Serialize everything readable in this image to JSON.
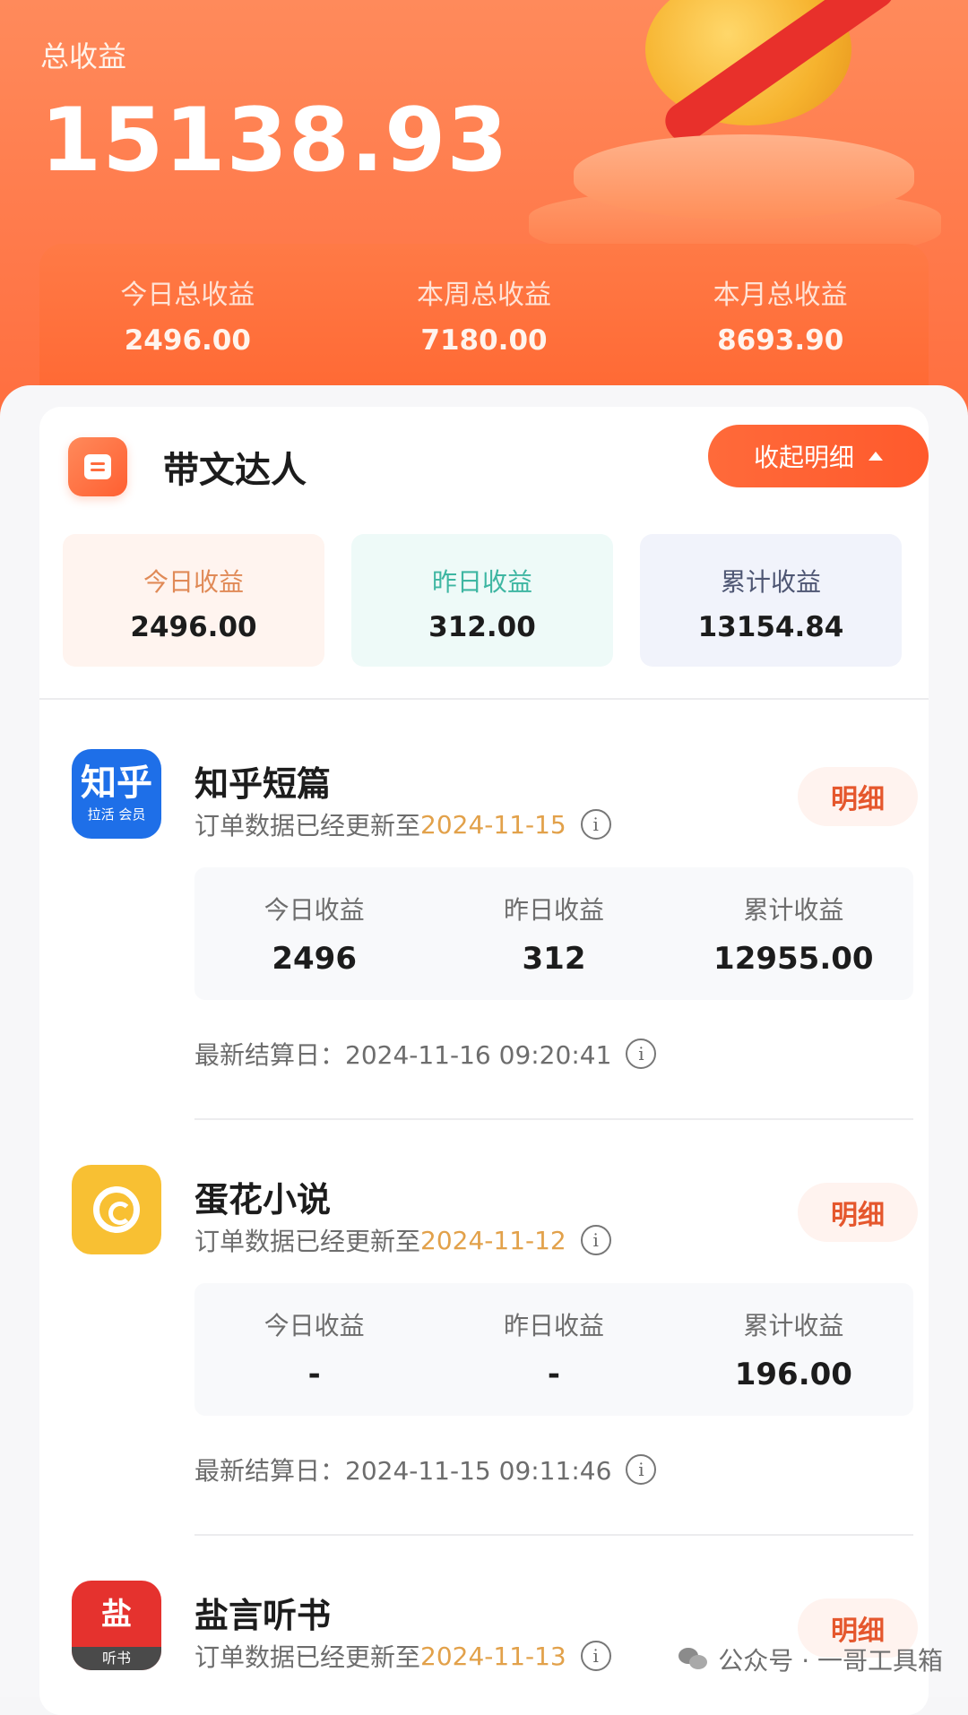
{
  "header": {
    "total_label": "总收益",
    "total_value": "15138.93",
    "summary": [
      {
        "label": "今日总收益",
        "value": "2496.00"
      },
      {
        "label": "本周总收益",
        "value": "7180.00"
      },
      {
        "label": "本月总收益",
        "value": "8693.90"
      }
    ]
  },
  "section": {
    "title": "带文达人",
    "collapse_label": "收起明细",
    "stats": [
      {
        "label": "今日收益",
        "value": "2496.00"
      },
      {
        "label": "昨日收益",
        "value": "312.00"
      },
      {
        "label": "累计收益",
        "value": "13154.84"
      }
    ]
  },
  "platforms": [
    {
      "name": "知乎短篇",
      "logo_text": "知乎",
      "logo_sub": "拉活 会员",
      "update_prefix": "订单数据已经更新至",
      "update_date": "2024-11-15",
      "detail_label": "明细",
      "stats": [
        {
          "label": "今日收益",
          "value": "2496"
        },
        {
          "label": "昨日收益",
          "value": "312"
        },
        {
          "label": "累计收益",
          "value": "12955.00"
        }
      ],
      "settle_label": "最新结算日：2024-11-16 09:20:41"
    },
    {
      "name": "蛋花小说",
      "update_prefix": "订单数据已经更新至",
      "update_date": "2024-11-12",
      "detail_label": "明细",
      "stats": [
        {
          "label": "今日收益",
          "value": "-"
        },
        {
          "label": "昨日收益",
          "value": "-"
        },
        {
          "label": "累计收益",
          "value": "196.00"
        }
      ],
      "settle_label": "最新结算日：2024-11-15 09:11:46"
    },
    {
      "name": "盐言听书",
      "logo_text": "盐",
      "logo_sub": "听书",
      "update_prefix": "订单数据已经更新至",
      "update_date": "2024-11-13",
      "detail_label": "明细"
    }
  ],
  "watermark": "公众号 · 一哥工具箱",
  "colors": {
    "accent": "#ff6a35",
    "date": "#e2a14a"
  }
}
